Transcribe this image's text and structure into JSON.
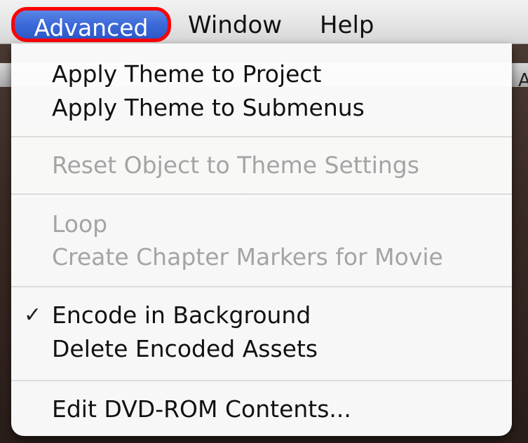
{
  "menubar": {
    "items": [
      "Advanced",
      "Window",
      "Help"
    ]
  },
  "background": {
    "partial_toolbar_letter": "A"
  },
  "advanced_menu": {
    "items": [
      {
        "label": "Apply Theme to Project",
        "enabled": true
      },
      {
        "label": "Apply Theme to Submenus",
        "enabled": true
      },
      {
        "label": "Reset Object to Theme Settings",
        "enabled": false
      },
      {
        "label": "Loop",
        "enabled": false
      },
      {
        "label": "Create Chapter Markers for Movie",
        "enabled": false
      },
      {
        "label": "Encode in Background",
        "enabled": true,
        "checked": true
      },
      {
        "label": "Delete Encoded Assets",
        "enabled": true
      },
      {
        "label": "Edit DVD-ROM Contents...",
        "enabled": true
      }
    ],
    "check_mark": "✓"
  },
  "colors": {
    "highlight": "#3c69d9",
    "annotation_outline": "#ff0000",
    "disabled_text": "#a4a4a4"
  }
}
